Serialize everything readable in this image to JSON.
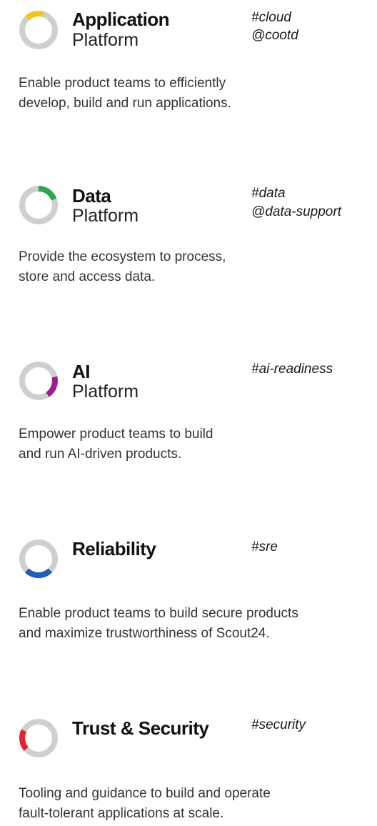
{
  "sections": [
    {
      "title": "Application",
      "subtitle": "Platform",
      "tags": [
        "#cloud",
        "@cootd"
      ],
      "description": [
        "Enable product teams to efficiently",
        "develop, build and run applications."
      ],
      "accent_color": "#f2c618",
      "icon": "ring-icon"
    },
    {
      "title": "Data",
      "subtitle": "Platform",
      "tags": [
        "#data",
        "@data-support"
      ],
      "description": [
        "Provide the ecosystem to process,",
        "store and access data."
      ],
      "accent_color": "#2fa84f",
      "icon": "ring-icon"
    },
    {
      "title": "AI",
      "subtitle": "Platform",
      "tags": [
        "#ai-readiness"
      ],
      "description": [
        "Empower product teams to build",
        "and run AI-driven products."
      ],
      "accent_color": "#9b1f8e",
      "icon": "ring-icon"
    },
    {
      "title": "Reliability",
      "subtitle": "",
      "tags": [
        "#sre"
      ],
      "description": [
        "Enable product teams to build secure products",
        "and maximize trustworthiness of Scout24."
      ],
      "accent_color": "#1f5fb8",
      "icon": "ring-icon"
    },
    {
      "title": "Trust & Security",
      "subtitle": "",
      "tags": [
        "#security"
      ],
      "description": [
        "Tooling and guidance to build and operate",
        "fault-tolerant applications at scale."
      ],
      "accent_color": "#e0252d",
      "icon": "ring-icon"
    }
  ],
  "ring_color": "#cfcfcf"
}
